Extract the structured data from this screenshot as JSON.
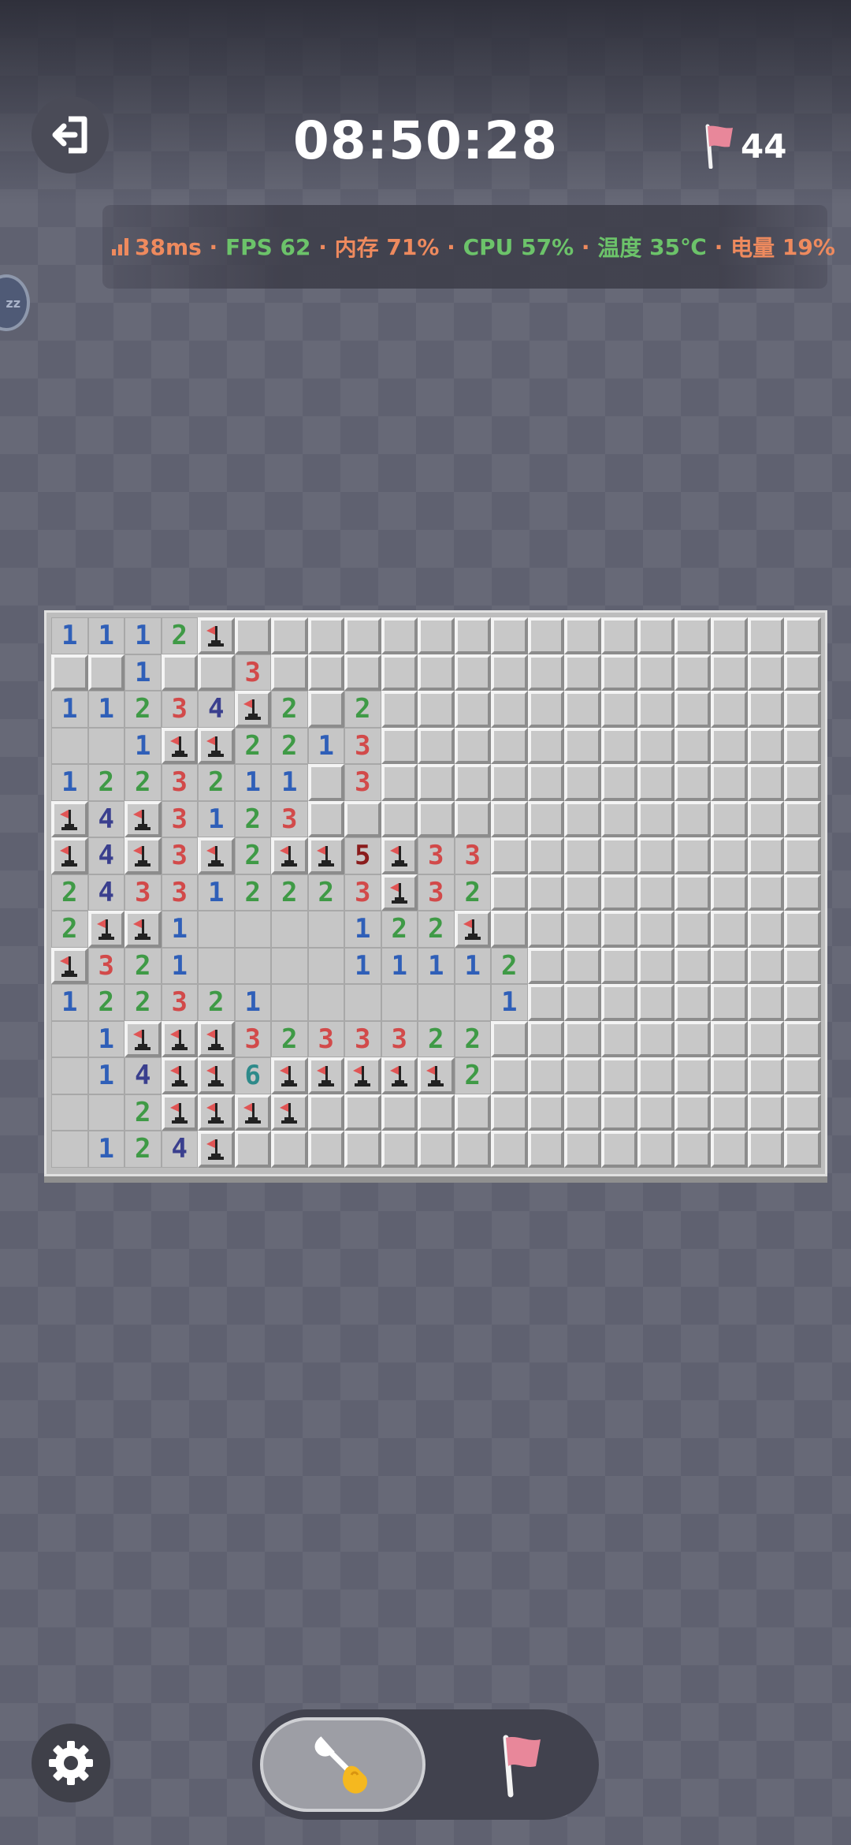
{
  "header": {
    "timer": "08:50:28",
    "flags_remaining": "44",
    "exit_icon": "exit-icon",
    "flag_icon": "flag-icon"
  },
  "status_bar": {
    "ping": "38ms",
    "fps_label": "FPS",
    "fps_value": "62",
    "memory_label": "内存",
    "memory_value": "71%",
    "cpu_label": "CPU",
    "cpu_value": "57%",
    "temp_label": "温度",
    "temp_value": "35℃",
    "battery_label": "电量",
    "battery_value": "19%",
    "separator": " · "
  },
  "side_bubble": "zz",
  "board": {
    "columns": 21,
    "rows": 15,
    "legend": {
      "U": "unrevealed",
      "F": "flag",
      "0": "empty",
      "1-8": "number"
    },
    "grid": [
      "1112FUUUUUUUUUUUUUUUU",
      "UU1UU3UUUUUUUUUUUUUUU",
      "11234F2U2UUUUUUUUUUUU",
      "001FF2213UUUUUUUUUUUU",
      "1223211U3UUUUUUUUUUUU",
      "F4F3123UUUUUUUUUUUUUU",
      "F4F3F2FF5F33UUUUUUUUU",
      "243312223F32UUUUUUUUU",
      "2FF10000122FUUUUUUUUU",
      "F321000011112UUUUUUUU",
      "1223210000001UUUUUUUU",
      "01FFF3233322UUUUUUUUU",
      "014FF6FFFFF2UUUUUUUUU",
      "002FFFFUUUUUUUUUUUUUU",
      "0124FUUUUUUUUUUUUUUUU"
    ]
  },
  "controls": {
    "settings_icon": "gear-icon",
    "dig_icon": "shovel-icon",
    "flag_mode_icon": "flag-icon",
    "active_mode": "dig"
  },
  "colors": {
    "n1": "#2f5fb8",
    "n2": "#3f9a46",
    "n3": "#d24a4a",
    "n4": "#3a3f8e",
    "n5": "#8a1c1c",
    "n6": "#2e8a8a",
    "status_orange": "#ee8a5e",
    "status_green": "#6cc36a",
    "flag_red": "#e05555"
  }
}
